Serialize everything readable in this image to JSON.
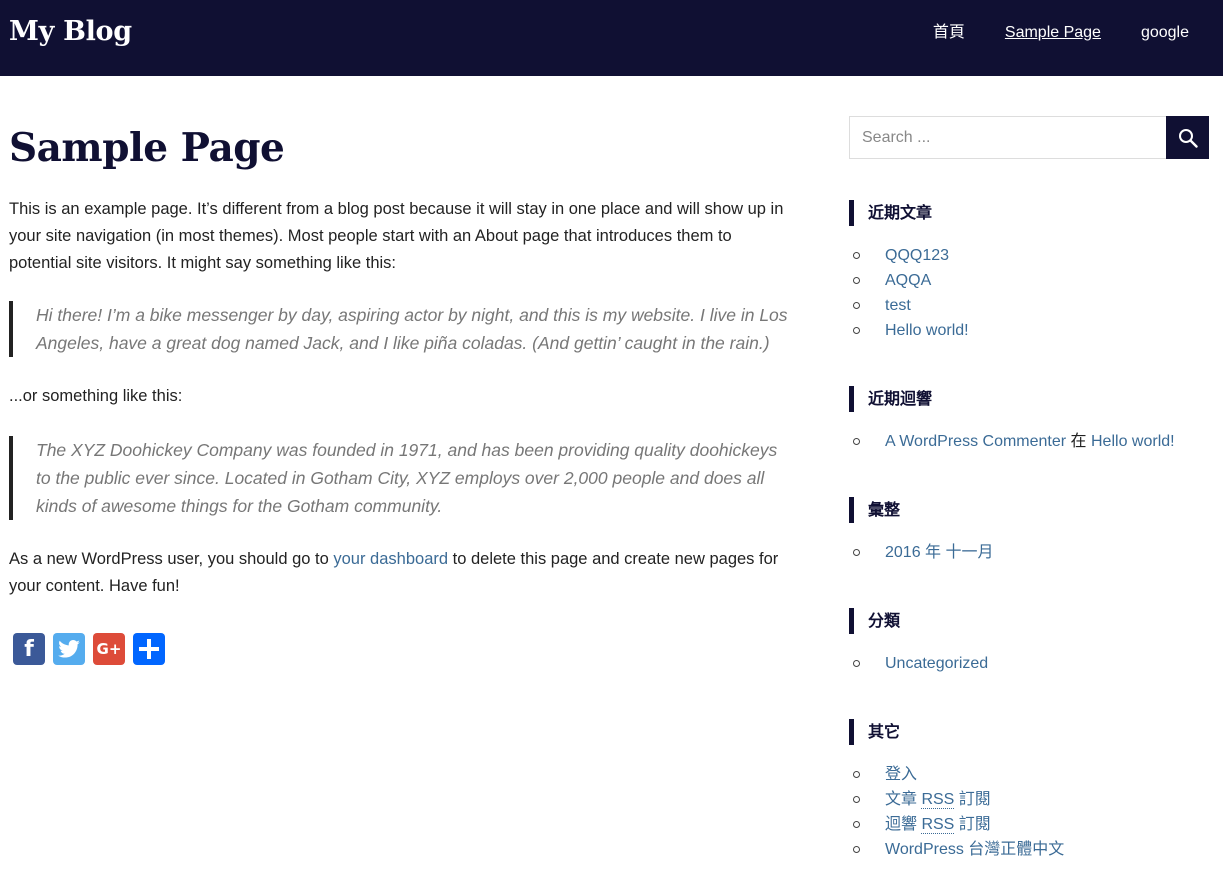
{
  "site": {
    "title": "My Blog"
  },
  "nav": {
    "items": [
      {
        "label": "首頁"
      },
      {
        "label": "Sample Page"
      },
      {
        "label": "google"
      }
    ]
  },
  "page": {
    "title": "Sample Page",
    "intro": "This is an example page. It’s different from a blog post because it will stay in one place and will show up in your site navigation (in most themes). Most people start with an About page that introduces them to potential site visitors. It might say something like this:",
    "quote1": "Hi there! I’m a bike messenger by day, aspiring actor by night, and this is my website. I live in Los Angeles, have a great dog named Jack, and I like piña coladas. (And gettin’ caught in the rain.)",
    "or_text": "...or something like this:",
    "quote2": "The XYZ Doohickey Company was founded in 1971, and has been providing quality doohickeys to the public ever since. Located in Gotham City, XYZ employs over 2,000 people and does all kinds of awesome things for the Gotham community.",
    "outro_before": "As a new WordPress user, you should go to ",
    "outro_link": "your dashboard",
    "outro_after": " to delete this page and create new pages for your content. Have fun!"
  },
  "share": {
    "facebook_glyph": "f",
    "googleplus_glyph": "G+",
    "icons": [
      "facebook-icon",
      "twitter-icon",
      "google-plus-icon",
      "share-plus-icon"
    ],
    "colors": {
      "facebook": "#3b5998",
      "twitter": "#55acee",
      "googleplus": "#dd4b39",
      "share": "#0166ff"
    }
  },
  "search": {
    "placeholder": "Search ..."
  },
  "widgets": {
    "recent_posts": {
      "title": "近期文章",
      "items": [
        "QQQ123",
        "AQQA",
        "test",
        "Hello world!"
      ]
    },
    "recent_comments": {
      "title": "近期迴響",
      "author": "A WordPress Commenter",
      "connector": " 在 ",
      "post": "Hello world!"
    },
    "archives": {
      "title": "彙整",
      "items": [
        "2016 年 十一月"
      ]
    },
    "categories": {
      "title": "分類",
      "items": [
        "Uncategorized"
      ]
    },
    "meta": {
      "title": "其它",
      "login": "登入",
      "entries_pre": "文章 ",
      "comments_pre": "迴響 ",
      "rss_abbr": "RSS",
      "feed_suffix": " 訂閱",
      "wordpress": "WordPress 台灣正體中文"
    }
  },
  "colors": {
    "header_bg": "#101033",
    "link": "#3b6b96",
    "quote_text": "#777777"
  }
}
